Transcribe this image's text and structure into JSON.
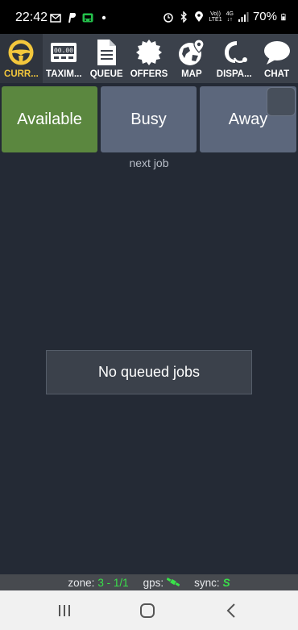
{
  "statusbar": {
    "time": "22:42",
    "lte_line1": "Vo))",
    "lte_line2": "LTE1",
    "net_line1": "4G",
    "net_line2": "↓↑",
    "battery": "70%"
  },
  "tabs": [
    {
      "label": "CURR...",
      "icon": "steering-wheel-icon",
      "active": true
    },
    {
      "label": "TAXIM...",
      "icon": "taximeter-icon",
      "active": false
    },
    {
      "label": "QUEUE",
      "icon": "document-icon",
      "active": false
    },
    {
      "label": "OFFERS",
      "icon": "badge-icon",
      "active": false
    },
    {
      "label": "MAP",
      "icon": "globe-pin-icon",
      "active": false
    },
    {
      "label": "DISPA...",
      "icon": "headset-icon",
      "active": false
    },
    {
      "label": "CHAT",
      "icon": "chat-bubble-icon",
      "active": false
    }
  ],
  "taximeter_display": "00.00",
  "status_buttons": {
    "available": "Available",
    "busy": "Busy",
    "away": "Away"
  },
  "next_job_label": "next job",
  "empty_message": "No queued jobs",
  "footer": {
    "zone_label": "zone:",
    "zone_value": "3 - 1/1",
    "gps_label": "gps:",
    "sync_label": "sync:",
    "sync_value": "S"
  },
  "colors": {
    "available": "#5b873f",
    "busy_away": "#5c677c",
    "active_tab_label": "#f3c73c",
    "status_value": "#39e24a"
  }
}
